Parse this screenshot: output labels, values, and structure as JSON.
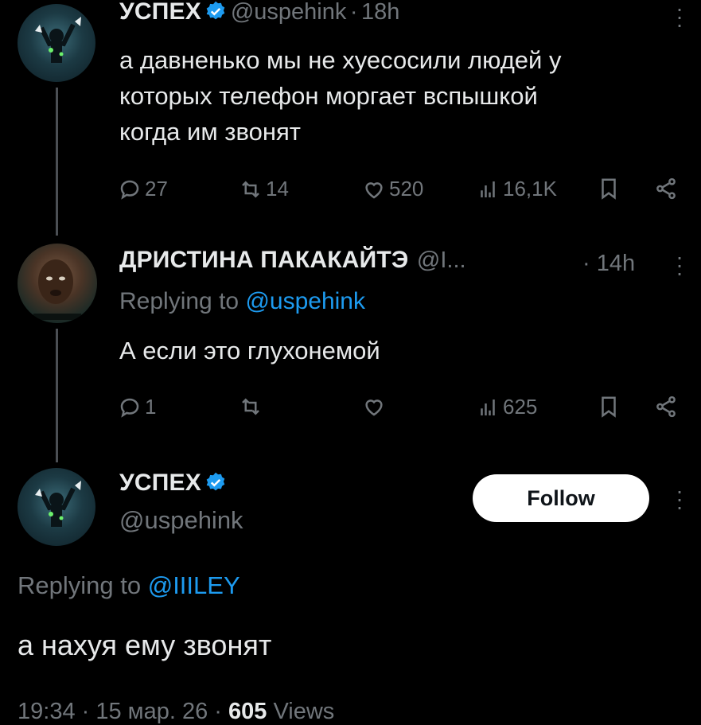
{
  "tweet1": {
    "display_name": "УСПЕХ",
    "handle": "@uspehink",
    "time": "18h",
    "text_lines": [
      "а давненько мы не хуесосили людей у",
      "которых телефон моргает вспышкой",
      "когда им звонят"
    ],
    "replies": "27",
    "retweets": "14",
    "likes": "520",
    "views": "16,1K"
  },
  "tweet2": {
    "display_name": "ДРИСТИНА ПАКАКАЙТЭ",
    "handle": "@I...",
    "time": "14h",
    "replying_prefix": "Replying to",
    "replying_handle": "@uspehink",
    "text": "А если это глухонемой",
    "replies": "1",
    "views": "625"
  },
  "tweet3": {
    "display_name": "УСПЕХ",
    "handle": "@uspehink",
    "follow_label": "Follow",
    "replying_prefix": "Replying to",
    "replying_handle": "@IIILEY",
    "text": "а нахуя ему звонят",
    "footer_time": "19:34 · 15 мар. 26 ·",
    "footer_views_count": "605",
    "footer_views_label": "Views"
  },
  "separator": "·",
  "colors": {
    "background": "#000000",
    "text": "#e7e9ea",
    "muted": "#71767b",
    "accent": "#1d9bf0",
    "line": "#4b4f54"
  }
}
